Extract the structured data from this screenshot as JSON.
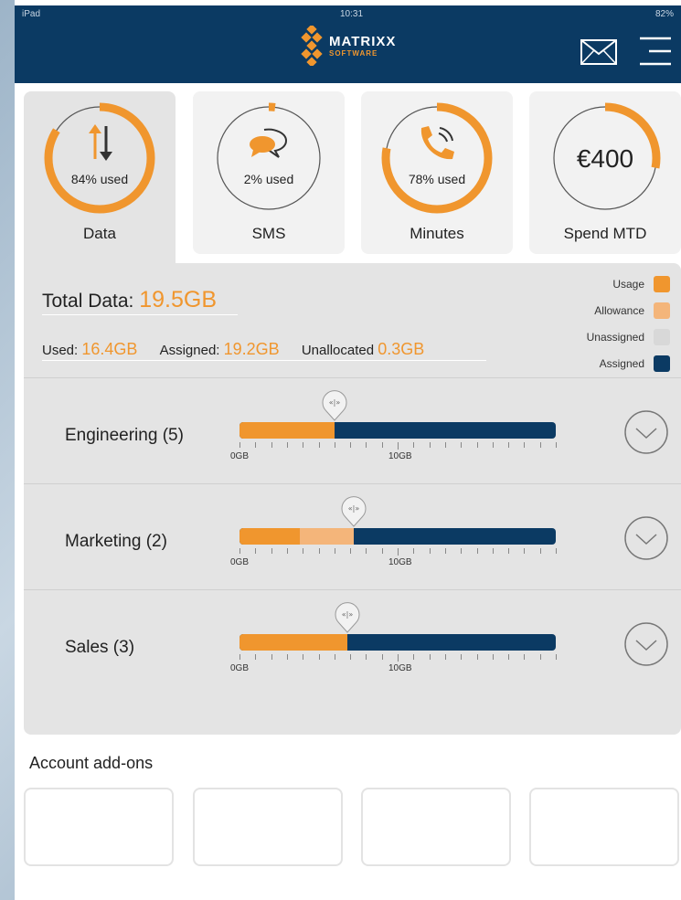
{
  "status_bar": {
    "device": "iPad",
    "time": "10:31",
    "battery": "82%"
  },
  "brand": {
    "name": "MATRIXX",
    "sub": "SOFTWARE"
  },
  "colors": {
    "orange": "#f0962e",
    "light_orange": "#f4b57a",
    "navy": "#0b3a63",
    "grey": "#d8d8d8"
  },
  "cards": [
    {
      "label": "Data",
      "used_text": "84% used",
      "percent": 84,
      "icon": "data-transfer-icon"
    },
    {
      "label": "SMS",
      "used_text": "2% used",
      "percent": 2,
      "icon": "chat-bubbles-icon"
    },
    {
      "label": "Minutes",
      "used_text": "78% used",
      "percent": 78,
      "icon": "phone-icon"
    },
    {
      "label": "Spend MTD",
      "amount": "€400",
      "percent": 28
    }
  ],
  "summary": {
    "total_label": "Total Data:",
    "total_value": "19.5GB",
    "used_label": "Used:",
    "used_value": "16.4GB",
    "assigned_label": "Assigned:",
    "assigned_value": "19.2GB",
    "unallocated_label": "Unallocated",
    "unallocated_value": "0.3GB"
  },
  "legend": [
    {
      "label": "Usage",
      "color": "#f0962e"
    },
    {
      "label": "Allowance",
      "color": "#f4b57a"
    },
    {
      "label": "Unassigned",
      "color": "#d8d8d8"
    },
    {
      "label": "Assigned",
      "color": "#0b3a63"
    }
  ],
  "handle_label": "«|»",
  "groups": [
    {
      "name": "Engineering (5)",
      "usage_pct": 30,
      "allowance_pct": 0,
      "tick_start": "0GB",
      "tick_mid": "10GB"
    },
    {
      "name": "Marketing (2)",
      "usage_pct": 19,
      "allowance_pct": 17,
      "tick_start": "0GB",
      "tick_mid": "10GB"
    },
    {
      "name": "Sales (3)",
      "usage_pct": 34,
      "allowance_pct": 0,
      "tick_start": "0GB",
      "tick_mid": "10GB"
    }
  ],
  "addons_title": "Account add-ons"
}
